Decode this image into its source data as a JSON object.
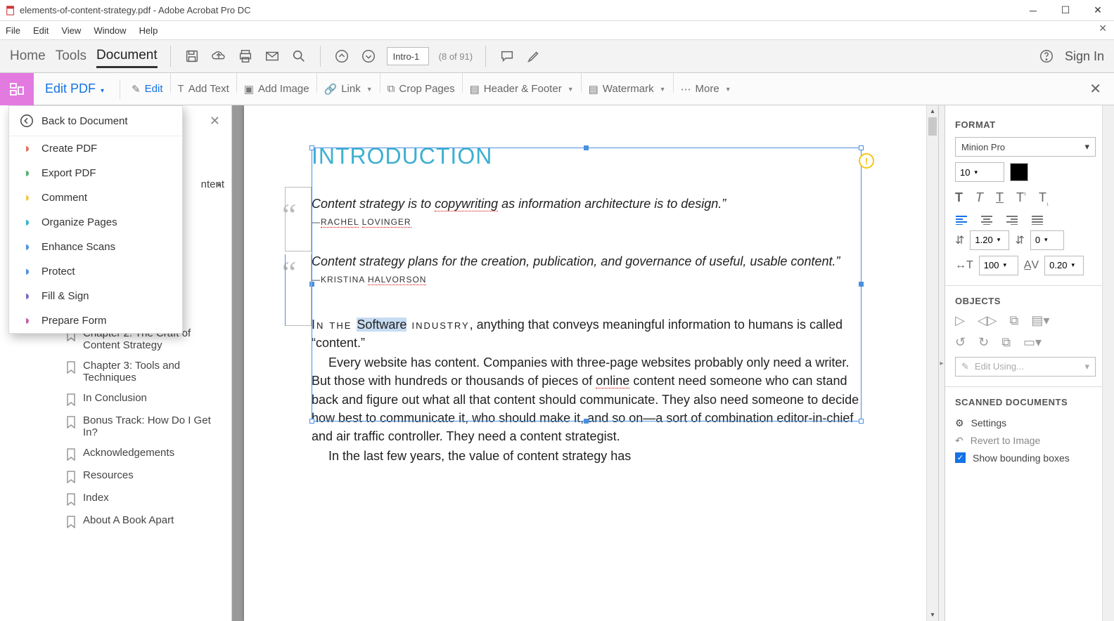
{
  "window": {
    "title": "elements-of-content-strategy.pdf - Adobe Acrobat Pro DC"
  },
  "menubar": [
    "File",
    "Edit",
    "View",
    "Window",
    "Help"
  ],
  "topbar": {
    "tabs": [
      "Home",
      "Tools",
      "Document"
    ],
    "active_tab": 2,
    "page_label": "Intro-1",
    "page_count": "(8 of 91)",
    "signin": "Sign In"
  },
  "editbar": {
    "label": "Edit PDF",
    "actions": [
      {
        "name": "edit",
        "label": "Edit",
        "caret": false,
        "blue": true
      },
      {
        "name": "add-text",
        "label": "Add Text",
        "caret": false
      },
      {
        "name": "add-image",
        "label": "Add Image",
        "caret": false
      },
      {
        "name": "link",
        "label": "Link",
        "caret": true
      },
      {
        "name": "crop",
        "label": "Crop Pages",
        "caret": false
      },
      {
        "name": "header-footer",
        "label": "Header & Footer",
        "caret": true
      },
      {
        "name": "watermark",
        "label": "Watermark",
        "caret": true
      },
      {
        "name": "more",
        "label": "More",
        "caret": true
      }
    ]
  },
  "backpanel": {
    "back": "Back to Document",
    "tools": [
      {
        "label": "Create PDF",
        "color": "#e0725e"
      },
      {
        "label": "Export PDF",
        "color": "#4fb06c"
      },
      {
        "label": "Comment",
        "color": "#f2c94c"
      },
      {
        "label": "Organize Pages",
        "color": "#2fb3c7"
      },
      {
        "label": "Enhance Scans",
        "color": "#4a90e2"
      },
      {
        "label": "Protect",
        "color": "#4a90e2"
      },
      {
        "label": "Fill & Sign",
        "color": "#8064c7"
      },
      {
        "label": "Prepare Form",
        "color": "#c05fa8"
      }
    ]
  },
  "outline_peek": "ntent",
  "outline": [
    "Chapter 2: The Craft of Content Strategy",
    "Chapter 3: Tools and Techniques",
    "In Conclusion",
    "Bonus Track: How Do I Get In?",
    "Acknowledgements",
    "Resources",
    "Index",
    "About A Book Apart"
  ],
  "document": {
    "heading": "INTRODUCTION",
    "quote1": "Content strategy is to copywriting as information architecture is to design.”",
    "attrib1": "—RACHEL LOVINGER",
    "quote2": "Content strategy plans for the creation, publication, and governance of useful, usable content.”",
    "attrib2": "—KRISTINA HALVORSON",
    "para1_pre": "In the ",
    "para1_sel": "Software",
    "para1_post": " industry, anything that conveys meaningful information to humans is called “content.”",
    "para2": "Every website has content. Companies with three-page websites probably only need a writer. But those with hundreds or thousands of pieces of online content need someone who can stand back and figure out what all that content should communicate. They also need someone to decide how best to communicate it, who should make it, and so on—a sort of combination editor-in-chief and air traffic controller. They need a content strategist.",
    "para3": "In the last few years, the value of content strategy has"
  },
  "format": {
    "title": "FORMAT",
    "font": "Minion Pro",
    "size": "10",
    "line_height": "1.20",
    "tracking": "0",
    "scale": "100",
    "char_spacing": "0.20"
  },
  "objects": {
    "title": "OBJECTS",
    "edit_using": "Edit Using..."
  },
  "scanned": {
    "title": "SCANNED DOCUMENTS",
    "settings": "Settings",
    "revert": "Revert to Image",
    "show_boxes": "Show bounding boxes"
  }
}
